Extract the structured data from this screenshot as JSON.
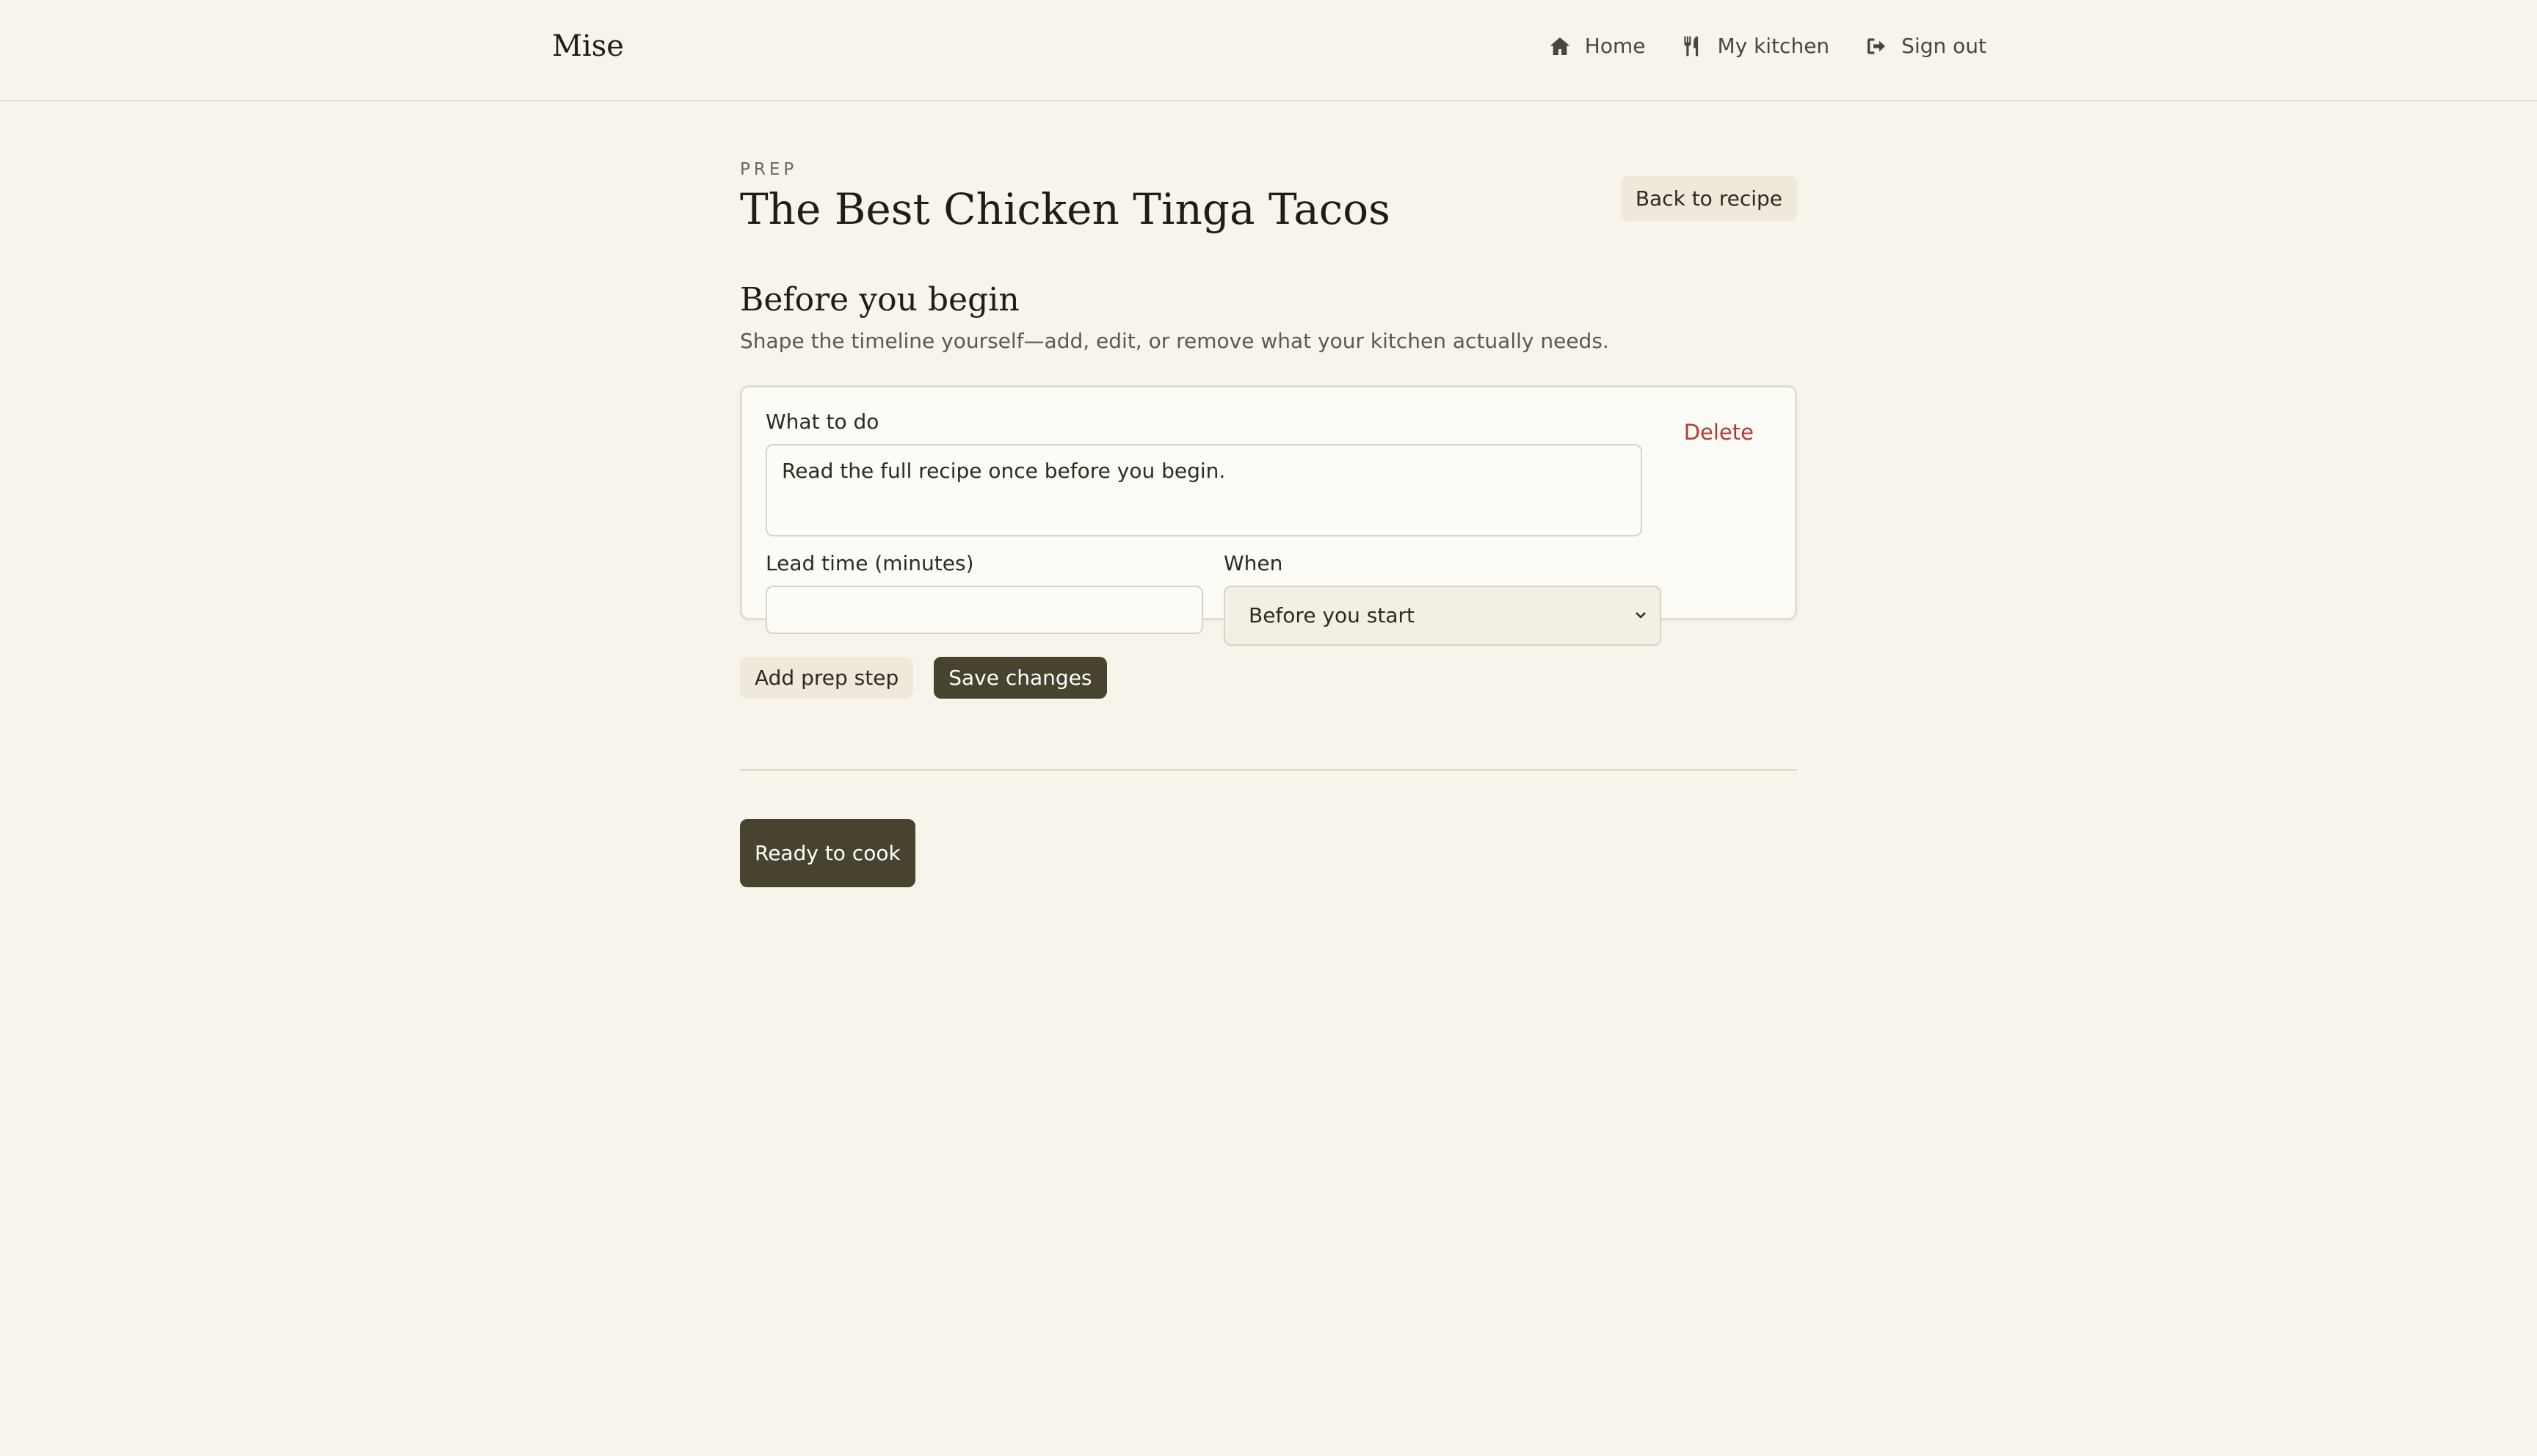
{
  "brand": "Mise",
  "nav": [
    {
      "label": "Home",
      "icon": "home-icon"
    },
    {
      "label": "My kitchen",
      "icon": "utensils-icon"
    },
    {
      "label": "Sign out",
      "icon": "sign-out-icon"
    }
  ],
  "header": {
    "eyebrow": "PREP",
    "title": "The Best Chicken Tinga Tacos",
    "back_label": "Back to recipe"
  },
  "section": {
    "title": "Before you begin",
    "subtitle": "Shape the timeline yourself—add, edit, or remove what your kitchen actually needs."
  },
  "prep_step": {
    "what_label": "What to do",
    "what_value": "Read the full recipe once before you begin.",
    "delete_label": "Delete",
    "lead_label": "Lead time (minutes)",
    "lead_value": "",
    "when_label": "When",
    "when_value": "Before you start"
  },
  "actions": {
    "add_label": "Add prep step",
    "save_label": "Save changes"
  },
  "cook": {
    "label": "Ready to cook"
  },
  "colors": {
    "background": "#f7f4ec",
    "dark_button": "#48432e",
    "light_button": "#efe8db",
    "danger": "#b23a32"
  }
}
